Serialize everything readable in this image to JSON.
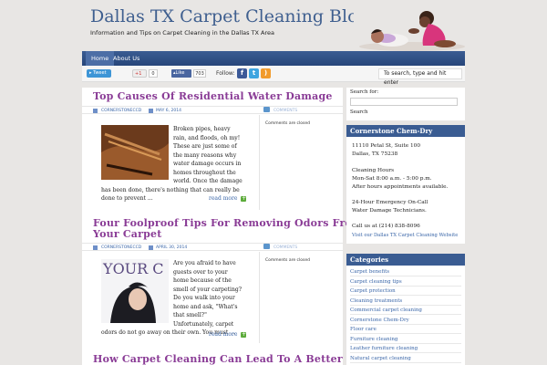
{
  "header": {
    "title": "Dallas TX Carpet Cleaning Blog",
    "description": "Information and Tips on Carpet Cleaning in the Dallas TX Area"
  },
  "nav": {
    "items": [
      {
        "label": "Home",
        "active": true
      },
      {
        "label": "About Us",
        "active": false
      }
    ]
  },
  "social": {
    "tweet_label": "Tweet",
    "gplus_label": "+1",
    "gplus_count": "0",
    "like_label": "Like",
    "like_count": "703",
    "follow_label": "Follow:",
    "icons": [
      "facebook-icon",
      "twitter-icon",
      "rss-icon"
    ],
    "search_placeholder": "To search, type and hit enter"
  },
  "posts": [
    {
      "title": "Top Causes Of Residential Water Damage",
      "author": "cornerstoneccd",
      "date": "May 6, 2014",
      "comments_link": "Comments",
      "comments_status": "Comments are closed",
      "excerpt": "Broken pipes, heavy rain, and floods, oh my! These are just some of the many reasons why water damage occurs in homes throughout the world. Once the damage has been done, there's nothing that can really be done to prevent ...",
      "read_more": "read more"
    },
    {
      "title": "Four Foolproof Tips For Removing Odors From Your Carpet",
      "title_line1": "Four Foolproof Tips For Removing Odors From",
      "title_line2": "Your Carpet",
      "author": "cornerstoneccd",
      "date": "April 30, 2014",
      "comments_link": "Comments",
      "comments_status": "Comments are closed",
      "excerpt": "Are you afraid to have guests over to your home because of the smell of your carpeting? Do you walk into your home and ask, \"What's that smell?\" Unfortunately, carpet odors do not go away on their own. You must ...",
      "thumb_text": "YOUR C",
      "read_more": "read more"
    },
    {
      "title": "How Carpet Cleaning Can Lead To A Better"
    }
  ],
  "sidebar": {
    "search_label": "Search for:",
    "search_button": "Search",
    "company": {
      "heading": "Cornerstone Chem-Dry",
      "address1": "11110 Petal St, Suite 100",
      "address2": "Dallas, TX 75238",
      "hours_title": "Cleaning Hours",
      "hours1": "Mon-Sat 8:00 a.m. - 5:00 p.m.",
      "hours2": "After hours appointments available.",
      "emergency1": "24-Hour Emergency On-Call",
      "emergency2": "Water Damage Technicians.",
      "phone": "Call us at (214) 838-8096",
      "website_link": "Visit our Dallas TX Carpet Cleaning Website"
    },
    "categories": {
      "heading": "Categories",
      "items": [
        "Carpet benefits",
        "Carpet cleaning tips",
        "Carpet protection",
        "Cleaning treatments",
        "Commercial carpet cleaning",
        "Cornerstone Chem-Dry",
        "Floor care",
        "Furniture cleaning",
        "Leather furniture cleaning",
        "Natural carpet cleaning"
      ]
    }
  },
  "colors": {
    "brand_blue": "#3a5c92",
    "post_title": "#8a3c96",
    "link": "#3a66a8",
    "background": "#e8e6e4"
  }
}
